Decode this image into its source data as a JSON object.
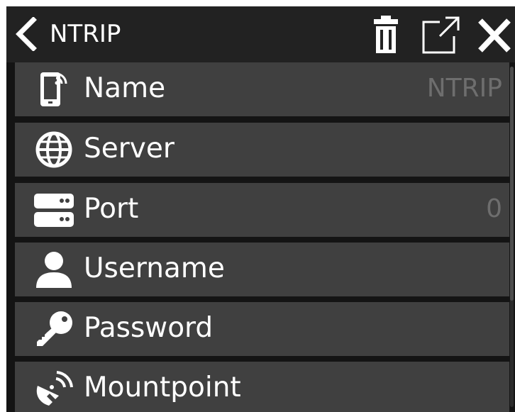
{
  "header": {
    "title": "NTRIP",
    "back_icon": "chevron-left-icon",
    "actions": [
      "trash-icon",
      "open-external-icon",
      "close-icon"
    ]
  },
  "fields": [
    {
      "label": "Name",
      "value": "NTRIP",
      "icon": "phone-signal-icon"
    },
    {
      "label": "Server",
      "value": "",
      "icon": "globe-icon"
    },
    {
      "label": "Port",
      "value": "0",
      "icon": "server-icon"
    },
    {
      "label": "Username",
      "value": "",
      "icon": "user-icon"
    },
    {
      "label": "Password",
      "value": "",
      "icon": "key-icon"
    },
    {
      "label": "Mountpoint",
      "value": "",
      "icon": "satellite-dish-icon"
    }
  ],
  "colors": {
    "background": "#141414",
    "header": "#222222",
    "row": "#404040",
    "text": "#ffffff",
    "value_text": "#6e6e6e"
  }
}
